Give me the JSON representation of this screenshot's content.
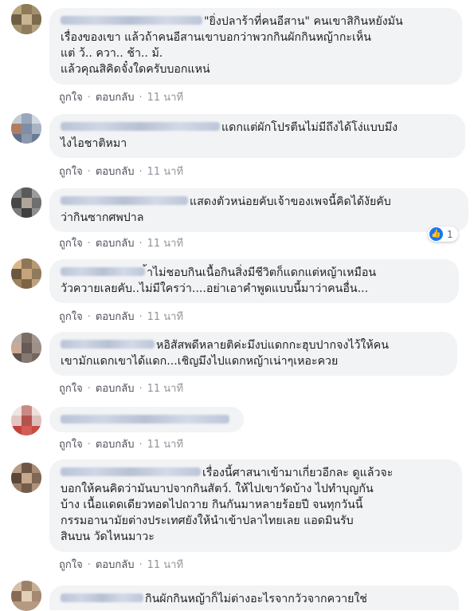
{
  "actions": {
    "like": "ถูกใจ",
    "reply": "ตอบกลับ",
    "separator": "·"
  },
  "comments": [
    {
      "lines": [
        "\"ยิ่งปลาร้าที่คนอีสาน\" คนเขาสิกินหยังมัน",
        "เรื่องของเขา แล้วถ้าคนอีสานเขาบอกว่าพวกกินผักกินหญ้ากะเห็น",
        "แต่ ว้.. ควา.. ช้า.. ม้.",
        "แล้วคุณสิคิดจั๋งใดครับบอกแหน่"
      ],
      "time": "11 นาที"
    },
    {
      "lines": [
        "แดกแต่ผักโปรตีนไม่มีถึงได้โง่แบบมึง",
        "ไงไอชาติหมา"
      ],
      "time": "11 นาที"
    },
    {
      "lines": [
        "แสดงตัวหน่อยคับเจ้าของเพจนี้คิดได้งัยคับ",
        "ว่ากินซากศพปาล"
      ],
      "time": "11 นาที",
      "reaction_count": "1"
    },
    {
      "lines": [
        "้าไม่ชอบกินเนื้อกินสิ่งมีชีวิตก็แดกแต่หญ้าเหมือน",
        "วัวควายเลยคับ..ไม่มีใครว่า....อย่าเอาคำพูดแบบนี้มาว่าคนอื่น..."
      ],
      "time": "11 นาที"
    },
    {
      "lines": [
        "หอิสัสพดีหลายติค่ะมึงบ่แดกกะฮุบปากจงไว้ให้คน",
        "เขามักแดกเขาได้แดก...เชิญมึงไปแดกหญ้าเน่าๆเหอะควย"
      ],
      "time": "11 นาที"
    },
    {
      "lines": [],
      "time": "11 นาที"
    },
    {
      "lines": [
        "เรื่องนี้ศาสนาเข้ามาเกี่ยวอีกละ ดูแล้วจะ",
        "บอกให้คนคิดว่ามันบาปจากกินสัตว์. ให้ไปเขาวัดบ้าง ไปทำบุญกัน",
        "บ้าง เนื้อแดดเดียวทอดไปถวาย กินกันมาหลายร้อยปี จนทุกวันนี้",
        "กรรมอานามัยต่างประเทศยังให้นำเข้าปลาไทยเลย แอดมินรับ",
        "สินบน วัดไหนมาวะ"
      ],
      "time": "11 นาที"
    },
    {
      "lines": [
        "กินผักกินหญ้าก็ไม่ต่างอะไรจากวัวจากควายใช่"
      ],
      "time": ""
    }
  ]
}
